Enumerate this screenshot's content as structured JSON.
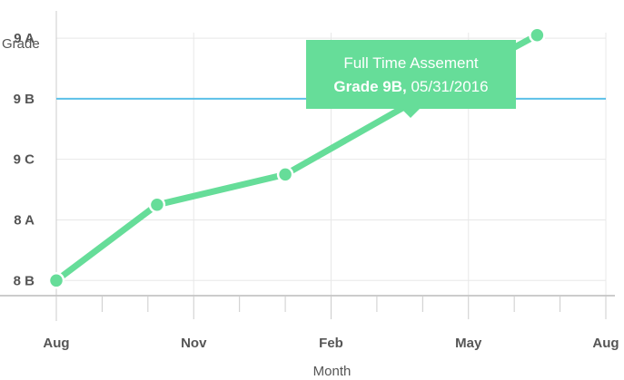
{
  "chart_data": {
    "type": "line",
    "xlabel": "Month",
    "ylabel": "Grade",
    "x_ticks": [
      "Aug",
      "Nov",
      "Feb",
      "May",
      "Aug"
    ],
    "y_ticks": [
      "8 B",
      "8 A",
      "9 C",
      "9 B",
      "9 A"
    ],
    "series": [
      {
        "color": "#66dd99",
        "points": [
          {
            "x": 0.0,
            "y": 0.0
          },
          {
            "x": 2.2,
            "y": 1.25
          },
          {
            "x": 5.0,
            "y": 1.75
          },
          {
            "x": 7.8,
            "y": 2.95
          },
          {
            "x": 10.5,
            "y": 4.05
          }
        ]
      }
    ],
    "reference_line": {
      "y": 3.0,
      "color": "#5bc0e8"
    },
    "xlim": [
      0,
      12
    ],
    "ylim": [
      -0.25,
      4.45
    ],
    "grid": true,
    "tooltip": {
      "title": "Full Time Assement",
      "value_bold": "Grade 9B,",
      "value_date": "05/31/2016"
    }
  }
}
